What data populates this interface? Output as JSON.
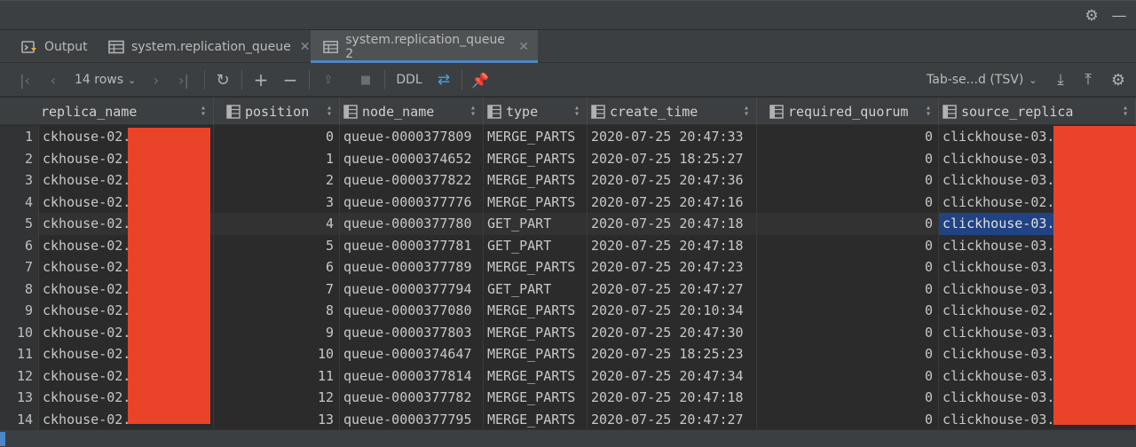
{
  "tabs": [
    {
      "label": "Output",
      "icon": "output-console-icon",
      "active": false
    },
    {
      "label": "system.replication_queue",
      "icon": "table-icon",
      "active": false
    },
    {
      "label": "system.replication_queue 2",
      "icon": "table-icon",
      "active": true
    }
  ],
  "toolbar": {
    "rows_label": "14 rows",
    "ddl_label": "DDL",
    "format_label": "Tab-se...d (TSV)"
  },
  "columns": [
    "replica_name",
    "position",
    "node_name",
    "type",
    "create_time",
    "required_quorum",
    "source_replica"
  ],
  "rows": [
    {
      "n": "1",
      "replica": "ckhouse-02.",
      "position": "0",
      "node": "queue-0000377809",
      "type": "MERGE_PARTS",
      "time": "2020-07-25 20:47:33",
      "quorum": "0",
      "source": "clickhouse-03."
    },
    {
      "n": "2",
      "replica": "ckhouse-02.",
      "position": "1",
      "node": "queue-0000374652",
      "type": "MERGE_PARTS",
      "time": "2020-07-25 18:25:27",
      "quorum": "0",
      "source": "clickhouse-03."
    },
    {
      "n": "3",
      "replica": "ckhouse-02.",
      "position": "2",
      "node": "queue-0000377822",
      "type": "MERGE_PARTS",
      "time": "2020-07-25 20:47:36",
      "quorum": "0",
      "source": "clickhouse-03."
    },
    {
      "n": "4",
      "replica": "ckhouse-02.",
      "position": "3",
      "node": "queue-0000377776",
      "type": "MERGE_PARTS",
      "time": "2020-07-25 20:47:16",
      "quorum": "0",
      "source": "clickhouse-02."
    },
    {
      "n": "5",
      "replica": "ckhouse-02.",
      "position": "4",
      "node": "queue-0000377780",
      "type": "GET_PART",
      "time": "2020-07-25 20:47:18",
      "quorum": "0",
      "source": "clickhouse-03."
    },
    {
      "n": "6",
      "replica": "ckhouse-02.",
      "position": "5",
      "node": "queue-0000377781",
      "type": "GET_PART",
      "time": "2020-07-25 20:47:18",
      "quorum": "0",
      "source": "clickhouse-03."
    },
    {
      "n": "7",
      "replica": "ckhouse-02.",
      "position": "6",
      "node": "queue-0000377789",
      "type": "MERGE_PARTS",
      "time": "2020-07-25 20:47:23",
      "quorum": "0",
      "source": "clickhouse-03."
    },
    {
      "n": "8",
      "replica": "ckhouse-02.",
      "position": "7",
      "node": "queue-0000377794",
      "type": "GET_PART",
      "time": "2020-07-25 20:47:27",
      "quorum": "0",
      "source": "clickhouse-03."
    },
    {
      "n": "9",
      "replica": "ckhouse-02.",
      "position": "8",
      "node": "queue-0000377080",
      "type": "MERGE_PARTS",
      "time": "2020-07-25 20:10:34",
      "quorum": "0",
      "source": "clickhouse-02."
    },
    {
      "n": "10",
      "replica": "ckhouse-02.",
      "position": "9",
      "node": "queue-0000377803",
      "type": "MERGE_PARTS",
      "time": "2020-07-25 20:47:30",
      "quorum": "0",
      "source": "clickhouse-03."
    },
    {
      "n": "11",
      "replica": "ckhouse-02.",
      "position": "10",
      "node": "queue-0000374647",
      "type": "MERGE_PARTS",
      "time": "2020-07-25 18:25:23",
      "quorum": "0",
      "source": "clickhouse-03."
    },
    {
      "n": "12",
      "replica": "ckhouse-02.",
      "position": "11",
      "node": "queue-0000377814",
      "type": "MERGE_PARTS",
      "time": "2020-07-25 20:47:34",
      "quorum": "0",
      "source": "clickhouse-03."
    },
    {
      "n": "13",
      "replica": "ckhouse-02.",
      "position": "12",
      "node": "queue-0000377782",
      "type": "MERGE_PARTS",
      "time": "2020-07-25 20:47:18",
      "quorum": "0",
      "source": "clickhouse-03."
    },
    {
      "n": "14",
      "replica": "ckhouse-02.",
      "position": "13",
      "node": "queue-0000377795",
      "type": "MERGE_PARTS",
      "time": "2020-07-25 20:47:27",
      "quorum": "0",
      "source": "clickhouse-03."
    }
  ],
  "selected_row": 5,
  "highlighted_cell": {
    "row": 5,
    "column": "source_replica"
  },
  "colors": {
    "background": "#2b2b2b",
    "panel": "#3c3f41",
    "active_tab_accent": "#4a88c7",
    "selection": "#214283",
    "redaction": "#e9432a"
  }
}
